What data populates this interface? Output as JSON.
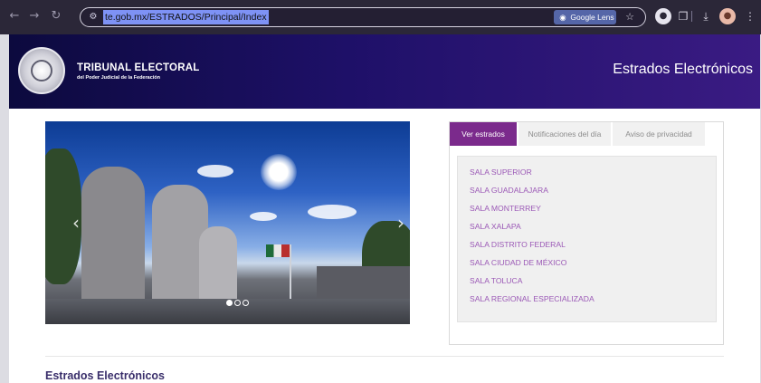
{
  "browser": {
    "url": "te.gob.mx/ESTRADOS/Principal/Index",
    "lens_label": "Google Lens",
    "icons": [
      "back-icon",
      "forward-icon",
      "reload-icon",
      "site-settings-icon",
      "google-lens-icon",
      "bookmark-star-icon",
      "extension-icon",
      "extensions-puzzle-icon",
      "download-icon",
      "profile-icon",
      "menu-icon"
    ]
  },
  "header": {
    "institution_name": "TRIBUNAL ELECTORAL",
    "institution_subtitle": "del Poder Judicial de la Federación",
    "site_title": "Estrados Electrónicos",
    "colors": {
      "gradient_start": "#0c0a3e",
      "gradient_end": "#3a1b83"
    }
  },
  "carousel": {
    "slide_count": 3,
    "active_slide": 1
  },
  "panel": {
    "tabs": [
      {
        "label": "Ver estrados",
        "active": true
      },
      {
        "label": "Notificaciones del día",
        "active": false
      },
      {
        "label": "Aviso de privacidad",
        "active": false
      }
    ],
    "salas": [
      "SALA SUPERIOR",
      "SALA GUADALAJARA",
      "SALA MONTERREY",
      "SALA XALAPA",
      "SALA DISTRITO FEDERAL",
      "SALA CIUDAD DE MÉXICO",
      "SALA TOLUCA",
      "SALA REGIONAL ESPECIALIZADA"
    ],
    "colors": {
      "accent": "#7b2a8c",
      "link": "#9b59b6"
    }
  },
  "main": {
    "section_title": "Estrados Electrónicos"
  }
}
